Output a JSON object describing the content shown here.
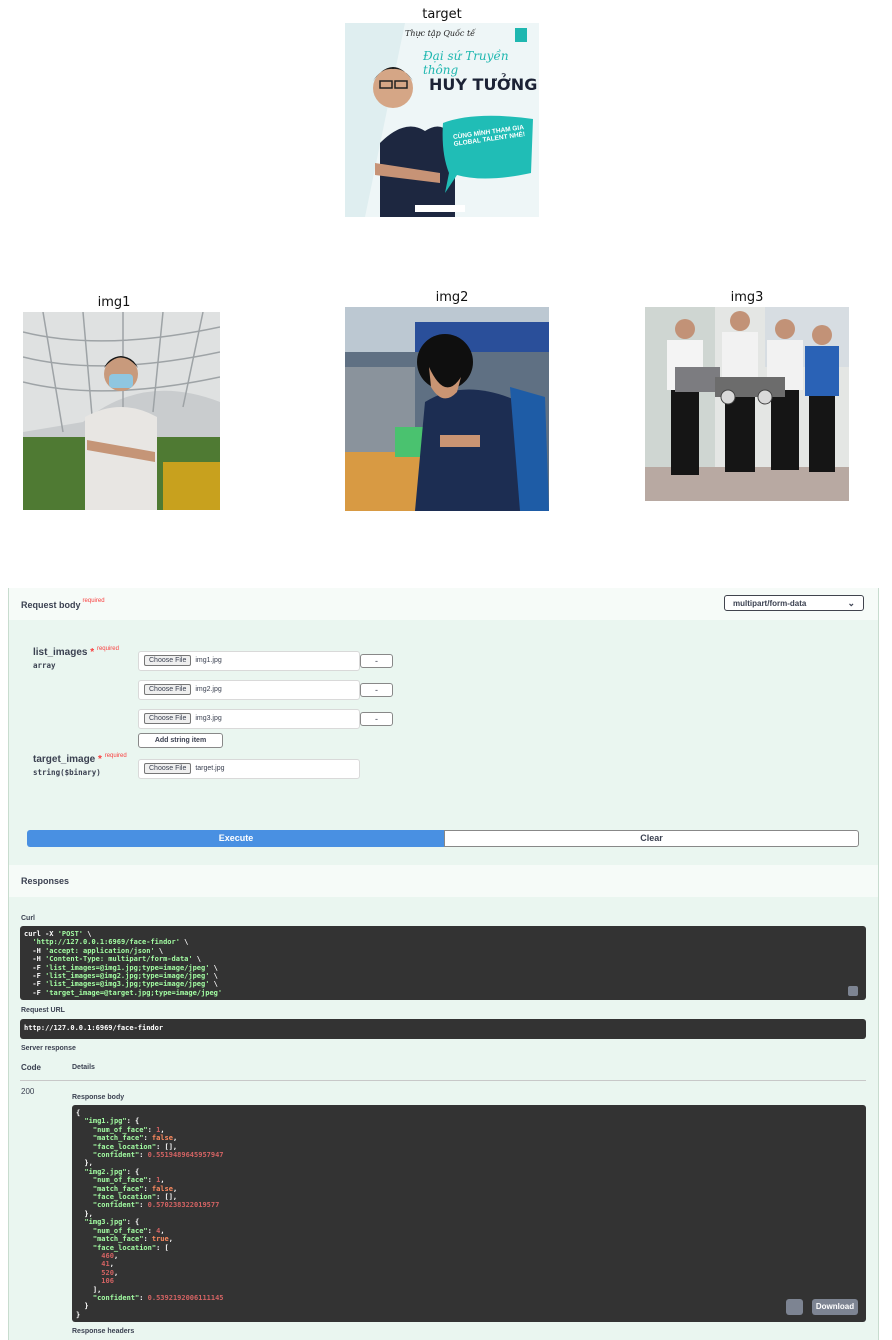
{
  "captions": {
    "target": "target",
    "img1": "img1",
    "img2": "img2",
    "img3": "img3"
  },
  "poster": {
    "line1": "Thực tập Quốc tế",
    "line2": "Đại sứ Truyền thông",
    "name": "HUY TƯỞNG",
    "bubble": "CÙNG MÌNH THAM GIA GLOBAL TALENT NHÉ!"
  },
  "request_body": {
    "title": "Request body",
    "required_label": "required",
    "content_type": "multipart/form-data"
  },
  "params": {
    "list_images": {
      "name": "list_images",
      "star": "*",
      "required_label": "required",
      "type": "array",
      "files": [
        "img1.jpg",
        "img2.jpg",
        "img3.jpg"
      ],
      "choose_label": "Choose File",
      "remove_label": "-",
      "add_label": "Add string item"
    },
    "target_image": {
      "name": "target_image",
      "star": "*",
      "required_label": "required",
      "type": "string($binary)",
      "file": "target.jpg",
      "choose_label": "Choose File"
    }
  },
  "buttons": {
    "execute": "Execute",
    "clear": "Clear"
  },
  "responses": {
    "title": "Responses",
    "curl_label": "Curl",
    "request_url_label": "Request URL",
    "request_url": "http://127.0.0.1:6969/face-findor",
    "server_response_label": "Server response",
    "code_header": "Code",
    "details_header": "Details",
    "status_code": "200",
    "response_body_label": "Response body",
    "download_label": "Download",
    "response_headers_label": "Response headers"
  },
  "curl_lines": [
    {
      "pre": "curl -X ",
      "str": "'POST'",
      "post": " \\"
    },
    {
      "pre": "  ",
      "str": "'http://127.0.0.1:6969/face-findor'",
      "post": " \\"
    },
    {
      "pre": "  -H ",
      "str": "'accept: application/json'",
      "post": " \\"
    },
    {
      "pre": "  -H ",
      "str": "'Content-Type: multipart/form-data'",
      "post": " \\"
    },
    {
      "pre": "  -F ",
      "str": "'list_images=@img1.jpg;type=image/jpeg'",
      "post": " \\"
    },
    {
      "pre": "  -F ",
      "str": "'list_images=@img2.jpg;type=image/jpeg'",
      "post": " \\"
    },
    {
      "pre": "  -F ",
      "str": "'list_images=@img3.jpg;type=image/jpeg'",
      "post": " \\"
    },
    {
      "pre": "  -F ",
      "str": "'target_image=@target.jpg;type=image/jpeg'",
      "post": ""
    }
  ],
  "response_json": [
    {
      "key": "img1.jpg",
      "num_of_face": "1",
      "match_face": "false",
      "face_location": "[]",
      "confident": "0.5519489645957947"
    },
    {
      "key": "img2.jpg",
      "num_of_face": "1",
      "match_face": "false",
      "face_location": "[]",
      "confident": "0.570238322019577"
    },
    {
      "key": "img3.jpg",
      "num_of_face": "4",
      "match_face": "true",
      "face_location": [
        "460",
        "41",
        "520",
        "106"
      ],
      "confident": "0.5392192006111145"
    }
  ],
  "colors": {
    "execute_blue": "#4990e2",
    "panel_green": "#eaf6f0",
    "code_bg": "#333333",
    "string_green": "#a2fca2",
    "number_red": "#d36363",
    "required_red": "#f93e3e"
  }
}
